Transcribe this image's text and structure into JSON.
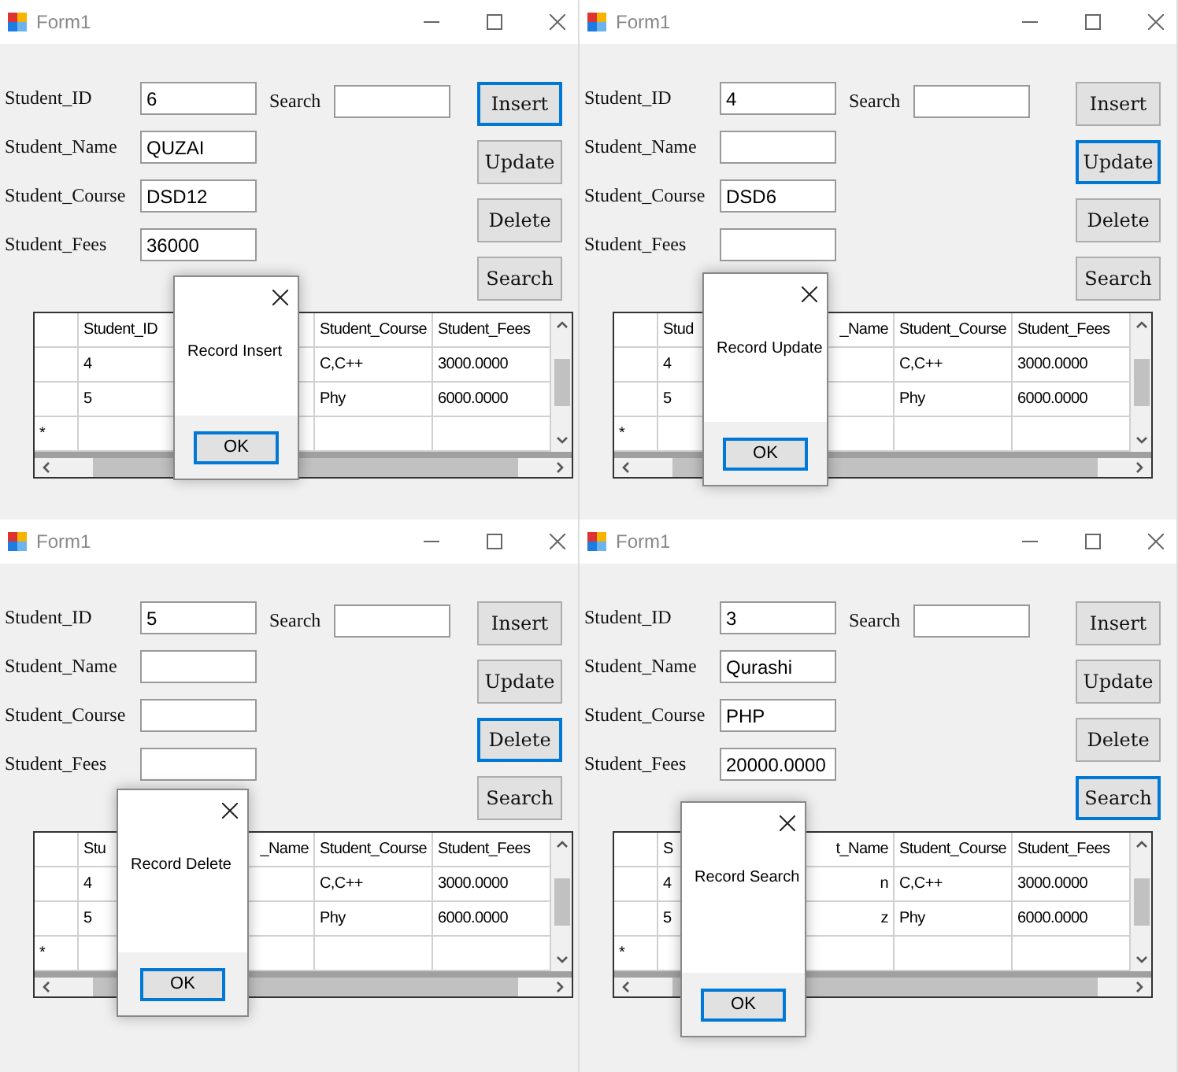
{
  "windows": [
    {
      "title": "Form1",
      "fields": [
        {
          "label": "Student_ID",
          "value": "6"
        },
        {
          "label": "Student_Name",
          "value": "QUZAI"
        },
        {
          "label": "Student_Course",
          "value": "DSD12"
        },
        {
          "label": "Student_Fees",
          "value": "36000"
        }
      ],
      "search": {
        "label": "Search"
      },
      "buttons": [
        {
          "label": "Insert",
          "focused": true
        },
        {
          "label": "Update",
          "focused": false
        },
        {
          "label": "Delete",
          "focused": false
        },
        {
          "label": "Search",
          "focused": false
        }
      ],
      "table": {
        "columns": [
          "Student_ID",
          "Student_Course",
          "Student_Fees"
        ],
        "rows": [
          [
            "4",
            "C,C++",
            "3000.0000"
          ],
          [
            "5",
            "Phy",
            "6000.0000"
          ]
        ],
        "new_row_marker": "*"
      },
      "dialog": {
        "message": "Record Insert",
        "button": "OK"
      }
    },
    {
      "title": "Form1",
      "fields": [
        {
          "label": "Student_ID",
          "value": "4"
        },
        {
          "label": "Student_Name"
        },
        {
          "label": "Student_Course",
          "value": "DSD6"
        },
        {
          "label": "Student_Fees"
        }
      ],
      "search": {
        "label": "Search"
      },
      "buttons": [
        {
          "label": "Insert",
          "focused": false
        },
        {
          "label": "Update",
          "focused": true
        },
        {
          "label": "Delete",
          "focused": false
        },
        {
          "label": "Search",
          "focused": false
        }
      ],
      "table": {
        "columns": [
          "Stud",
          "_Name",
          "Student_Course",
          "Student_Fees"
        ],
        "rows": [
          [
            "4",
            "",
            "C,C++",
            "3000.0000"
          ],
          [
            "5",
            "",
            "Phy",
            "6000.0000"
          ]
        ],
        "new_row_marker": "*"
      },
      "dialog": {
        "message": "Record Update",
        "button": "OK"
      }
    },
    {
      "title": "Form1",
      "fields": [
        {
          "label": "Student_ID",
          "value": "5"
        },
        {
          "label": "Student_Name"
        },
        {
          "label": "Student_Course"
        },
        {
          "label": "Student_Fees"
        }
      ],
      "search": {
        "label": "Search"
      },
      "buttons": [
        {
          "label": "Insert",
          "focused": false
        },
        {
          "label": "Update",
          "focused": false
        },
        {
          "label": "Delete",
          "focused": true
        },
        {
          "label": "Search",
          "focused": false
        }
      ],
      "table": {
        "columns": [
          "Stu",
          "_Name",
          "Student_Course",
          "Student_Fees"
        ],
        "rows": [
          [
            "4",
            "",
            "C,C++",
            "3000.0000"
          ],
          [
            "5",
            "",
            "Phy",
            "6000.0000"
          ]
        ],
        "new_row_marker": "*"
      },
      "dialog": {
        "message": "Record Delete",
        "button": "OK"
      }
    },
    {
      "title": "Form1",
      "fields": [
        {
          "label": "Student_ID",
          "value": "3"
        },
        {
          "label": "Student_Name",
          "value": "Qurashi"
        },
        {
          "label": "Student_Course",
          "value": "PHP"
        },
        {
          "label": "Student_Fees",
          "value": "20000.0000"
        }
      ],
      "search": {
        "label": "Search"
      },
      "buttons": [
        {
          "label": "Insert",
          "focused": false
        },
        {
          "label": "Update",
          "focused": false
        },
        {
          "label": "Delete",
          "focused": false
        },
        {
          "label": "Search",
          "focused": true
        }
      ],
      "table": {
        "columns": [
          "S",
          "t_Name",
          "Student_Course",
          "Student_Fees"
        ],
        "rows": [
          [
            "4",
            "n",
            "C,C++",
            "3000.0000"
          ],
          [
            "5",
            "z",
            "Phy",
            "6000.0000"
          ]
        ],
        "new_row_marker": "*"
      },
      "dialog": {
        "message": "Record Search",
        "button": "OK"
      }
    }
  ]
}
